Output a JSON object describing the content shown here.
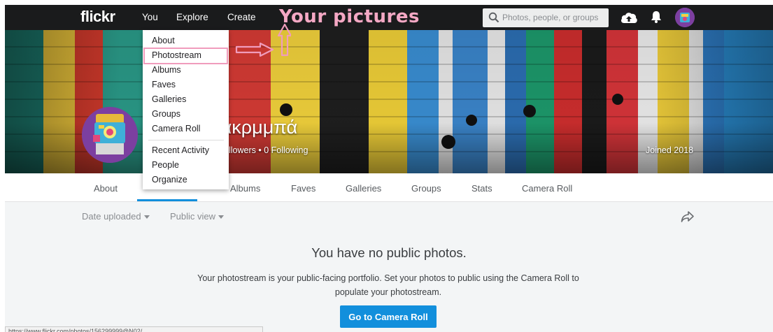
{
  "topnav": {
    "logo": "flickr",
    "links": [
      "You",
      "Explore",
      "Create"
    ],
    "annotation_title": "Your pictures",
    "search_placeholder": "Photos, people, or groups"
  },
  "you_menu": {
    "items": [
      "About",
      "Photostream",
      "Albums",
      "Faves",
      "Galleries",
      "Groups",
      "Camera Roll"
    ],
    "secondary_items": [
      "Recent Activity",
      "People",
      "Organize"
    ],
    "highlighted": "Photostream"
  },
  "profile": {
    "name": "σακρμμπά",
    "stats": "llowers  •  0 Following",
    "joined": "Joined 2018"
  },
  "subnav": {
    "tabs": [
      "About",
      "Albums",
      "Faves",
      "Galleries",
      "Groups",
      "Stats",
      "Camera Roll"
    ]
  },
  "toolbar": {
    "sort_label": "Date uploaded",
    "view_label": "Public view"
  },
  "empty_state": {
    "title": "You have no public photos.",
    "description": "Your photostream is your public-facing portfolio. Set your photos to public using the Camera Roll to populate your photostream.",
    "button_label": "Go to Camera Roll"
  },
  "status_bar": {
    "url": "https://www.flickr.com/photos/156299999@N02/"
  },
  "colors": {
    "accent": "#128fdc",
    "nav_bg": "#1a1b1c",
    "annotation": "#f09cbc"
  }
}
